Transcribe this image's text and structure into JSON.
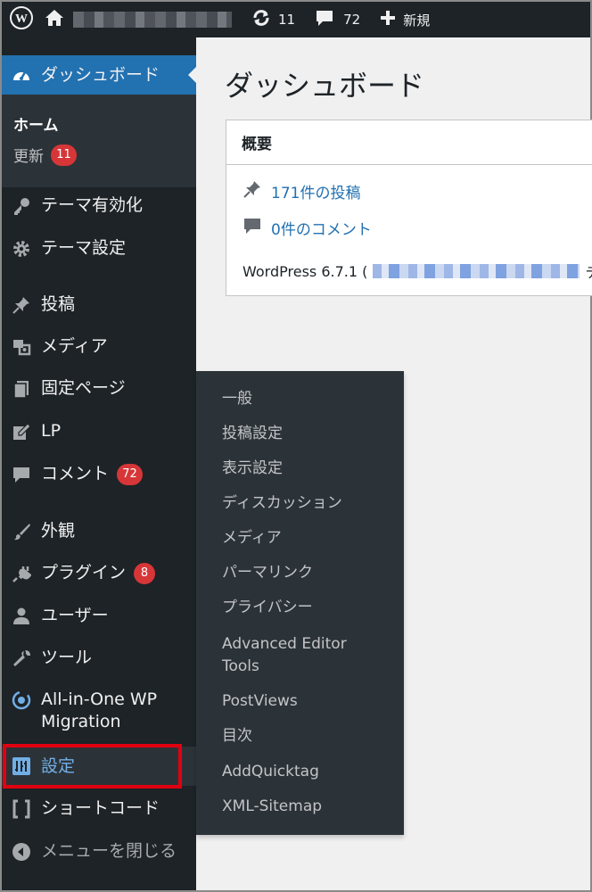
{
  "adminbar": {
    "updates_count": "11",
    "comments_count": "72",
    "new_label": "新規"
  },
  "sidebar": {
    "dashboard": "ダッシュボード",
    "home": "ホーム",
    "update": "更新",
    "update_badge": "11",
    "items": [
      {
        "label": "テーマ有効化"
      },
      {
        "label": "テーマ設定"
      },
      {
        "label": "投稿"
      },
      {
        "label": "メディア"
      },
      {
        "label": "固定ページ"
      },
      {
        "label": "LP"
      },
      {
        "label": "コメント",
        "badge": "72"
      },
      {
        "label": "外観"
      },
      {
        "label": "プラグイン",
        "badge": "8"
      },
      {
        "label": "ユーザー"
      },
      {
        "label": "ツール"
      },
      {
        "label": "All-in-One WP Migration"
      },
      {
        "label": "設定"
      },
      {
        "label": "ショートコード"
      },
      {
        "label": "メニューを閉じる"
      }
    ]
  },
  "flyout": {
    "items": [
      "一般",
      "投稿設定",
      "表示設定",
      "ディスカッション",
      "メディア",
      "パーマリンク",
      "プライバシー",
      "Advanced Editor Tools",
      "PostViews",
      "目次",
      "AddQuicktag",
      "XML-Sitemap"
    ]
  },
  "main": {
    "title": "ダッシュボード",
    "panel_title": "概要",
    "posts": "171件の投稿",
    "comments": "0件のコメント",
    "wp_version_prefix": "WordPress 6.7.1 (",
    "wp_version_suffix": "テ"
  },
  "colors": {
    "adminbar_bg": "#1d2327",
    "menu_bg": "#1d2327",
    "submenu_bg": "#2c3338",
    "accent": "#2271b1",
    "badge": "#d63638",
    "highlight_box": "#e10010"
  },
  "icons": {
    "adminbar": [
      "wordpress-icon",
      "home-icon",
      "update-icon",
      "comment-icon",
      "plus-icon"
    ],
    "menu": [
      "dashboard-icon",
      "key-icon",
      "gear-icon",
      "pin-icon",
      "media-icon",
      "pages-icon",
      "edit-icon",
      "comment-icon",
      "paintbrush-icon",
      "plugin-icon",
      "user-icon",
      "wrench-icon",
      "migration-icon",
      "settings-icon",
      "shortcode-icon",
      "collapse-icon"
    ]
  }
}
